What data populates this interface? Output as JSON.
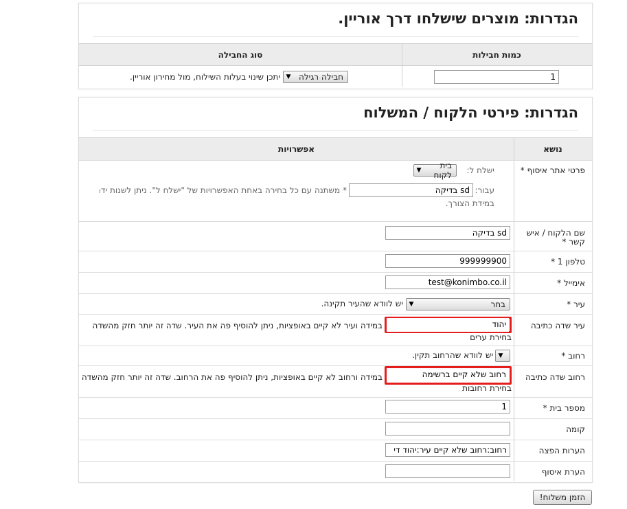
{
  "panel1": {
    "title": "הגדרות: מוצרים שישלחו דרך אוריין.",
    "col_packages": "כמות חבילות",
    "col_type": "סוג החבילה",
    "packages_value": "1",
    "type_value": "חבילה רגילה",
    "type_note": "יתכן שינוי בעלות השילוח, מול מחירון אוריין."
  },
  "panel2": {
    "title": "הגדרות: פירטי הלקוח / המשלוח",
    "col_subject": "נושא",
    "col_options": "אפשרויות",
    "rows": {
      "pickup": {
        "label": "פרטי אתר איסוף *",
        "send_to_label": "ישלח ל:",
        "send_to_value": "בית לקוח",
        "for_label": "עבור:",
        "for_value": "sd בדיקה",
        "for_note_a": "* משתנה עם כל בחירה באחת האפשרויות של \"ישלח ל\". ניתן לשנות ידני",
        "for_note_b": "במידת הצורך."
      },
      "customer": {
        "label_a": "שם הלקוח / איש",
        "label_b": "קשר *",
        "value": "sd בדיקה"
      },
      "phone": {
        "label": "טלפון 1 *",
        "value": "999999900"
      },
      "email": {
        "label": "אימייל *",
        "value": "test@konimbo.co.il"
      },
      "city": {
        "label": "עיר *",
        "value": "בחר",
        "note": "יש לוודא שהעיר תקינה."
      },
      "city_text": {
        "label": "עיר שדה כתיבה",
        "value": "יהוד",
        "note_a": "במידה ועיר לא קיים באופציות, ניתן להוסיף פה את העיר. שדה זה יותר חזק מהשדה",
        "note_b": "בחירת ערים"
      },
      "street": {
        "label": "רחוב *",
        "value": "",
        "note": "יש לוודא שהרחוב תקין."
      },
      "street_text": {
        "label": "רחוב שדה כתיבה",
        "value": "רחוב שלא קיים ברשימה",
        "note_a": "במידה ורחוב לא קיים באופציות, ניתן להוסיף פה את הרחוב. שדה זה יותר חזק מהשדה",
        "note_b": "בחירת רחובות"
      },
      "house": {
        "label": "מספר בית *",
        "value": "1"
      },
      "floor": {
        "label": "קומה",
        "value": ""
      },
      "delivery_notes": {
        "label": "הערות הפצה",
        "value": "רחוב:רחוב שלא קיים עיר:יהוד די"
      },
      "pickup_note": {
        "label": "הערת איסוף",
        "value": ""
      }
    }
  },
  "submit_label": "הזמן משלוח!",
  "colors": {
    "highlight": "#e51c1c",
    "header_bg": "#ececec"
  }
}
